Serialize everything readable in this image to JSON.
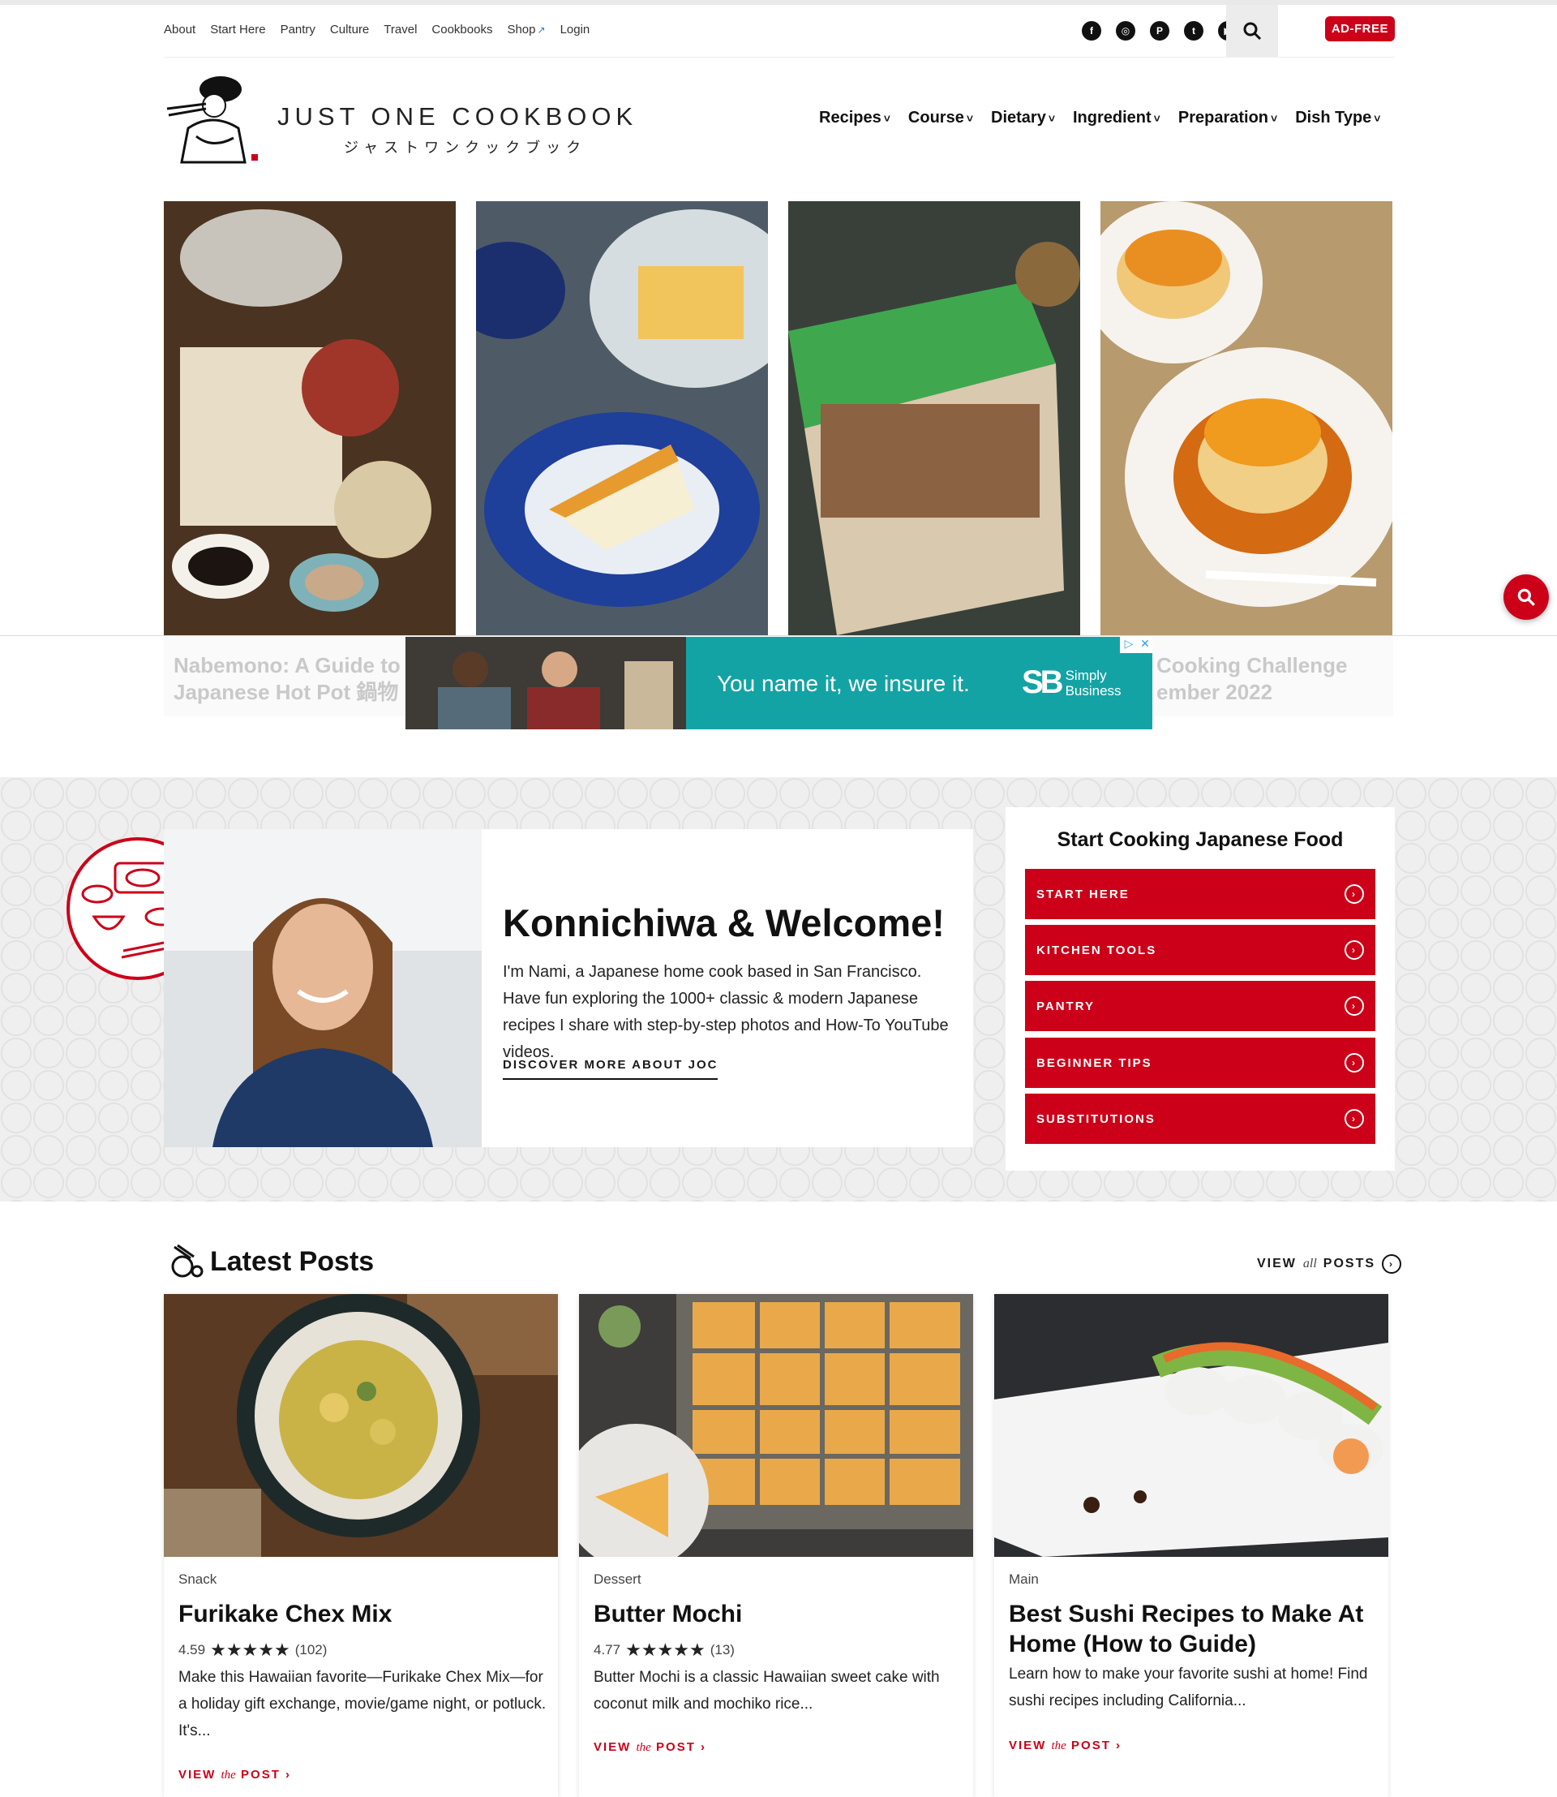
{
  "util_nav": [
    "About",
    "Start Here",
    "Pantry",
    "Culture",
    "Travel",
    "Cookbooks",
    "Shop",
    "Login"
  ],
  "social_icons": [
    "facebook-icon",
    "instagram-icon",
    "pinterest-icon",
    "twitter-icon",
    "youtube-icon"
  ],
  "ad_free": "AD-FREE",
  "logo": {
    "title": "JUST ONE COOKBOOK",
    "subtitle": "ジャストワンクックブック"
  },
  "main_nav": [
    "Recipes",
    "Course",
    "Dietary",
    "Ingredient",
    "Preparation",
    "Dish Type"
  ],
  "featured": [
    {
      "title": "Nabemono: A Guide to Japanese Hot Pot 鍋物"
    },
    {
      "title": ""
    },
    {
      "title": ""
    },
    {
      "title": "Cooking Challenge ember 2022"
    }
  ],
  "ad": {
    "tagline": "You name it, we insure it.",
    "brand_mark": "SB",
    "brand_name_1": "Simply",
    "brand_name_2": "Business"
  },
  "welcome": {
    "heading": "Konnichiwa & Welcome!",
    "body": "I'm Nami, a Japanese home cook based in San Francisco. Have fun exploring the 1000+ classic & modern Japanese recipes I share with step-by-step photos and How-To YouTube videos.",
    "link": "DISCOVER MORE ABOUT JOC"
  },
  "start": {
    "heading": "Start Cooking Japanese Food",
    "buttons": [
      "START HERE",
      "KITCHEN TOOLS",
      "PANTRY",
      "BEGINNER TIPS",
      "SUBSTITUTIONS"
    ]
  },
  "latest": {
    "heading": "Latest Posts",
    "view_all_1": "VIEW",
    "view_all_2": "all",
    "view_all_3": "POSTS",
    "link_1": "VIEW",
    "link_2": "the",
    "link_3": "POST",
    "posts": [
      {
        "category": "Snack",
        "title": "Furikake Chex Mix",
        "rating": "4.59",
        "count": "(102)",
        "excerpt": "Make this Hawaiian favorite—Furikake Chex Mix—for a holiday gift exchange, movie/game night, or potluck. It's..."
      },
      {
        "category": "Dessert",
        "title": "Butter Mochi",
        "rating": "4.77",
        "count": "(13)",
        "excerpt": "Butter Mochi is a classic Hawaiian sweet cake with coconut milk and mochiko rice..."
      },
      {
        "category": "Main",
        "title": "Best Sushi Recipes to Make At Home (How to Guide)",
        "excerpt": "Learn how to make your favorite sushi at home! Find sushi recipes including California..."
      }
    ]
  },
  "colors": {
    "brand_red": "#cc0018",
    "ad_teal": "#14a3a4"
  }
}
